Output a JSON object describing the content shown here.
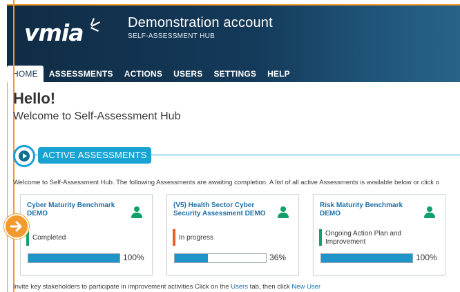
{
  "header": {
    "logo": "vmia",
    "account_title": "Demonstration account",
    "account_subtitle": "SELF-ASSESSMENT HUB"
  },
  "nav": {
    "items": [
      {
        "label": "HOME",
        "active": true
      },
      {
        "label": "ASSESSMENTS",
        "active": false
      },
      {
        "label": "ACTIONS",
        "active": false
      },
      {
        "label": "USERS",
        "active": false
      },
      {
        "label": "SETTINGS",
        "active": false
      },
      {
        "label": "HELP",
        "active": false
      }
    ]
  },
  "main": {
    "greeting": "Hello!",
    "welcome": "Welcome to Self-Assessment Hub",
    "active_section_label": "ACTIVE ASSESSMENTS",
    "intro_text": "Welcome to Self-Assessment Hub. The following Assessments are awaiting completion. A list of all active Assessments is available below or click o",
    "cards": [
      {
        "title": "Cyber Maturity Benchmark DEMO",
        "status": "Completed",
        "status_color": "#12a06a",
        "progress_percent": 100,
        "progress_label": "100%"
      },
      {
        "title": "(V5) Health Sector Cyber Security Assessment DEMO",
        "status": "In progress",
        "status_color": "#e8602a",
        "progress_percent": 36,
        "progress_label": "36%"
      },
      {
        "title": "Risk Maturity Benchmark DEMO",
        "status": "Ongoing Action Plan and Improvement",
        "status_color": "#12a06a",
        "progress_percent": 100,
        "progress_label": "100%"
      }
    ],
    "bottom_text_prefix": "Invite key stakeholders to participate in improvement activities Click on the ",
    "bottom_link_users": "Users",
    "bottom_text_mid": " tab, then click ",
    "bottom_link_new_user": "New User"
  },
  "colors": {
    "header_dark": "#102c45",
    "accent_blue": "#19a3d3",
    "progress_blue": "#1f94c8",
    "highlight_orange": "#f39a2e",
    "status_green": "#12a06a",
    "status_orange": "#e8602a"
  },
  "icons": {
    "logo_mark": "star-burst-icon",
    "play": "play-circle-icon",
    "user": "user-icon",
    "arrow": "arrow-right-icon"
  }
}
